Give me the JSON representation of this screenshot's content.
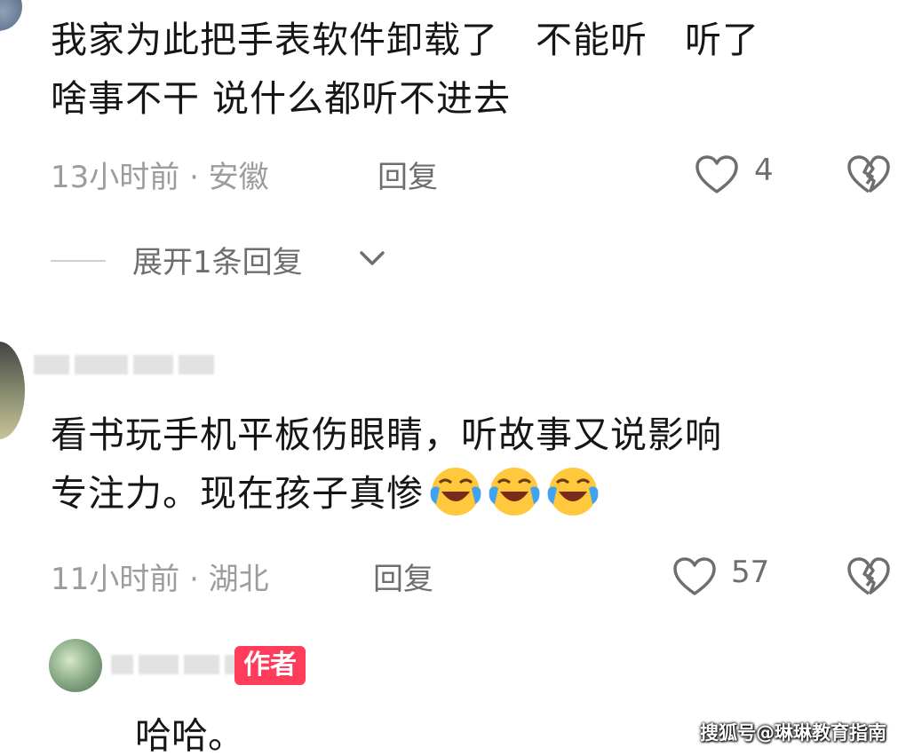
{
  "comments": [
    {
      "text_lines": [
        "我家为此把手表软件卸载了　不能听　听了",
        "啥事不干  说什么都听不进去"
      ],
      "time_location": "13小时前 · 安徽",
      "reply_label": "回复",
      "likes": "4"
    },
    {
      "text_lines": [
        "看书玩手机平板伤眼睛，听故事又说影响",
        "专注力。现在孩子真惨"
      ],
      "emoji_count": 3,
      "emoji_name": "laughing-crying-emoji",
      "time_location": "11小时前 · 湖北",
      "reply_label": "回复",
      "likes": "57"
    }
  ],
  "expand_replies_label": "展开1条回复",
  "author_reply": {
    "badge": "作者",
    "text": "哈哈。"
  },
  "watermark": "搜狐号@琳琳教育指南",
  "colors": {
    "text": "#161616",
    "meta": "#9c9c9c",
    "badge": "#ff3d5a",
    "emoji_face": "#ffc83d",
    "tears": "#3fa3f2"
  },
  "icons": {
    "like": "heart-outline-icon",
    "dislike": "broken-heart-icon",
    "expand": "chevron-down-icon"
  }
}
